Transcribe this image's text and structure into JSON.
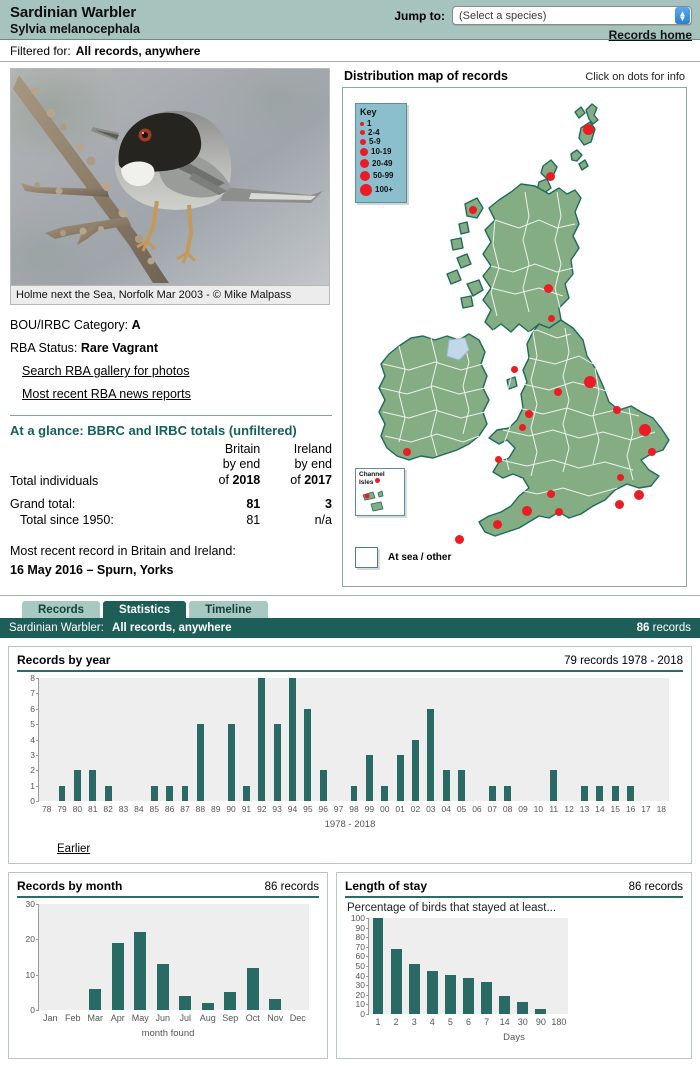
{
  "header": {
    "common_name": "Sardinian Warbler",
    "scientific_name": "Sylvia melanocephala",
    "jump_label": "Jump to:",
    "jump_selected": "(Select a species)",
    "records_home": "Records home",
    "filtered_prefix": "Filtered for:",
    "filtered_value": "All records, anywhere"
  },
  "photo": {
    "caption": "Holme next the Sea, Norfolk Mar 2003 - © Mike Malpass"
  },
  "meta": {
    "category_label": "BOU/IRBC Category:",
    "category_value": "A",
    "status_label": "RBA Status:",
    "status_value": "Rare Vagrant",
    "link_gallery": "Search RBA gallery for photos",
    "link_news": "Most recent RBA news reports"
  },
  "glance": {
    "title": "At a glance: BBRC and IRBC totals (unfiltered)",
    "row_label": "Total individuals",
    "britain_head": [
      "Britain",
      "by end",
      "of ",
      "2018"
    ],
    "ireland_head": [
      "Ireland",
      "by end",
      "of ",
      "2017"
    ],
    "rows": [
      {
        "label": "Grand total:",
        "britain": "81",
        "ireland": "3",
        "bold": true
      },
      {
        "label": "Total since 1950:",
        "britain": "81",
        "ireland": "n/a",
        "bold": false
      }
    ],
    "recent_label": "Most recent record in Britain and Ireland:",
    "recent_value": "16 May 2016  – Spurn, Yorks"
  },
  "map": {
    "title": "Distribution map of records",
    "hint": "Click on dots for info",
    "key_title": "Key",
    "key_items": [
      "1",
      "2-4",
      "5-9",
      "10-19",
      "20-49",
      "50-99",
      "100+"
    ],
    "channel_isles": "Channel Isles",
    "at_sea": "At sea / other",
    "dot_color": "#ec1c24",
    "land_color": "#84ad83",
    "sea_color": "#ffffff"
  },
  "tabs": [
    {
      "label": "Records",
      "active": false
    },
    {
      "label": "Statistics",
      "active": true
    },
    {
      "label": "Timeline",
      "active": false
    }
  ],
  "statusbar": {
    "species": "Sardinian Warbler:",
    "filter": "All records, anywhere",
    "count": "86",
    "count_suffix": " records"
  },
  "earlier_link": "Earlier",
  "chart_data": [
    {
      "type": "bar",
      "title": "Records by year",
      "subtitle": "79 records 1978 - 2018",
      "xlabel": "1978 - 2018",
      "ylabel": "",
      "ylim": [
        0,
        8
      ],
      "yticks": [
        0,
        1,
        2,
        3,
        4,
        5,
        6,
        7,
        8
      ],
      "grid": false,
      "categories": [
        "78",
        "79",
        "80",
        "81",
        "82",
        "83",
        "84",
        "85",
        "86",
        "87",
        "88",
        "89",
        "90",
        "91",
        "92",
        "93",
        "94",
        "95",
        "96",
        "97",
        "98",
        "99",
        "00",
        "01",
        "02",
        "03",
        "04",
        "05",
        "06",
        "07",
        "08",
        "09",
        "10",
        "11",
        "12",
        "13",
        "14",
        "15",
        "16",
        "17",
        "18"
      ],
      "values": [
        0,
        1,
        2,
        2,
        1,
        0,
        0,
        1,
        1,
        1,
        5,
        0,
        5,
        1,
        8,
        5,
        8,
        6,
        2,
        0,
        1,
        3,
        1,
        3,
        4,
        6,
        2,
        2,
        0,
        1,
        1,
        0,
        0,
        2,
        0,
        1,
        1,
        1,
        1,
        0,
        0
      ],
      "bar_color": "#2a6a65"
    },
    {
      "type": "bar",
      "title": "Records by month",
      "subtitle": "86 records",
      "xlabel": "month found",
      "ylabel": "",
      "ylim": [
        0,
        30
      ],
      "yticks": [
        0,
        10,
        20,
        30
      ],
      "grid": false,
      "categories": [
        "Jan",
        "Feb",
        "Mar",
        "Apr",
        "May",
        "Jun",
        "Jul",
        "Aug",
        "Sep",
        "Oct",
        "Nov",
        "Dec"
      ],
      "values": [
        0,
        0,
        6,
        19,
        22,
        13,
        4,
        2,
        5,
        12,
        3,
        0
      ],
      "bar_color": "#2a6a65"
    },
    {
      "type": "bar",
      "title": "Length of stay",
      "subtitle": "86 records",
      "caption": "Percentage of birds that stayed at least...",
      "xlabel": "Days",
      "ylabel": "",
      "ylim": [
        0,
        100
      ],
      "yticks": [
        0,
        10,
        20,
        30,
        40,
        50,
        60,
        70,
        80,
        90,
        100
      ],
      "grid": false,
      "categories": [
        "1",
        "2",
        "3",
        "4",
        "5",
        "6",
        "7",
        "14",
        "30",
        "90",
        "180"
      ],
      "values": [
        100,
        68,
        52,
        45,
        41,
        38,
        33,
        19,
        13,
        5,
        0
      ],
      "bar_color": "#2a6a65"
    }
  ]
}
